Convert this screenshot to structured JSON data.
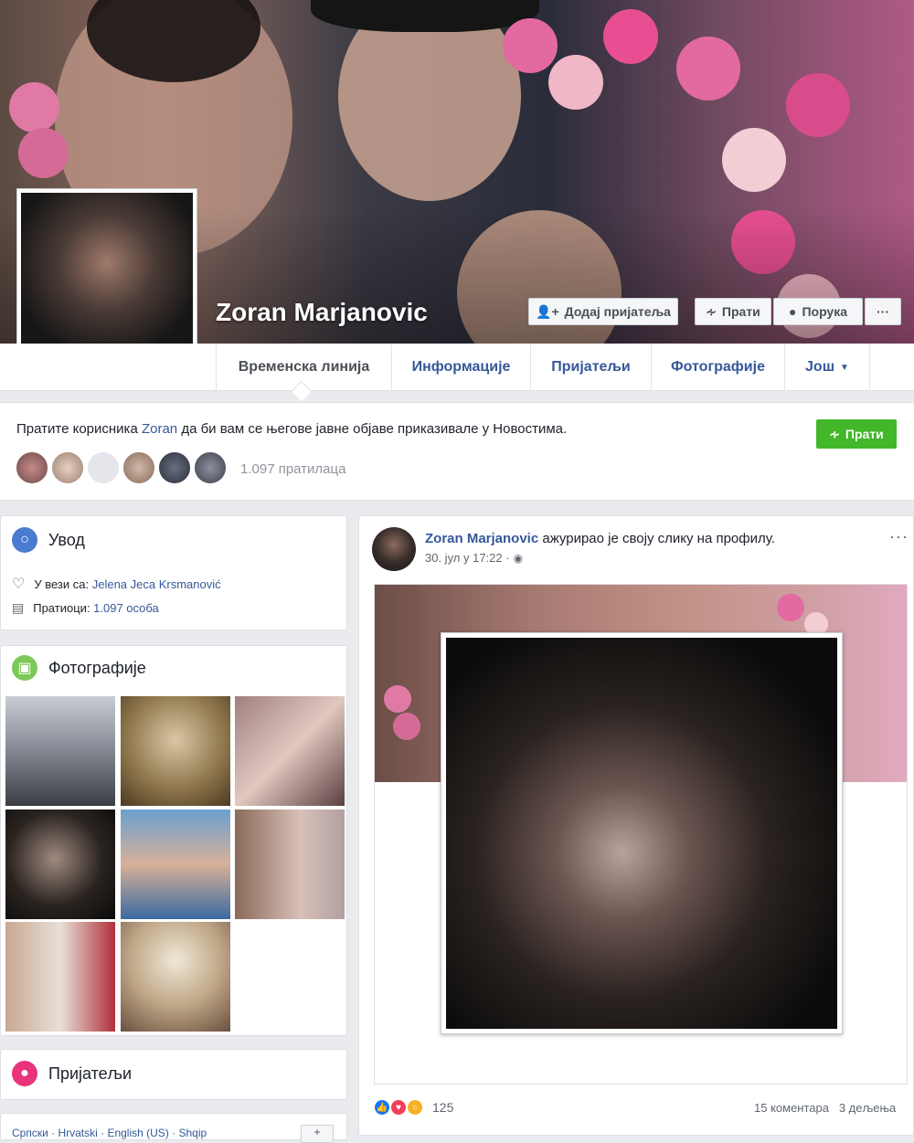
{
  "profile": {
    "name": "Zoran Marjanovic",
    "buttons": {
      "add_friend": "Додај пријатеља",
      "follow": "Прати",
      "message": "Порука",
      "more": "···"
    }
  },
  "nav": {
    "tabs": [
      "Временска линија",
      "Информације",
      "Пријатељи",
      "Фотографије",
      "Још"
    ]
  },
  "follow_banner": {
    "text_before": "Пратите корисника ",
    "text_name": "Zoran",
    "text_after": " да би вам се његове јавне објаве приказивале у Новостима.",
    "button": "Прати",
    "followers": "1.097 пратилаца"
  },
  "intro": {
    "title": "Увод",
    "relationship_label": "У вези са: ",
    "relationship_name": "Jelena Jeca Krsmanović",
    "followers_label": "Пратиоци: ",
    "followers_value": "1.097 особа"
  },
  "photos": {
    "title": "Фотографије"
  },
  "friends": {
    "title": "Пријатељи"
  },
  "languages": {
    "text": "Српски · Hrvatski · English (US) · Shqip"
  },
  "post": {
    "author": "Zoran Marjanovic",
    "action": " ажурирао је своју слику на профилу.",
    "time": "30. јул у 17:22 ·",
    "more": "···",
    "reactions_count": "125",
    "comments": "15 коментара",
    "shares": "3 дељења"
  },
  "colors": {
    "link": "#365899",
    "follow_green": "#42b72a",
    "background": "#e9ebee"
  }
}
